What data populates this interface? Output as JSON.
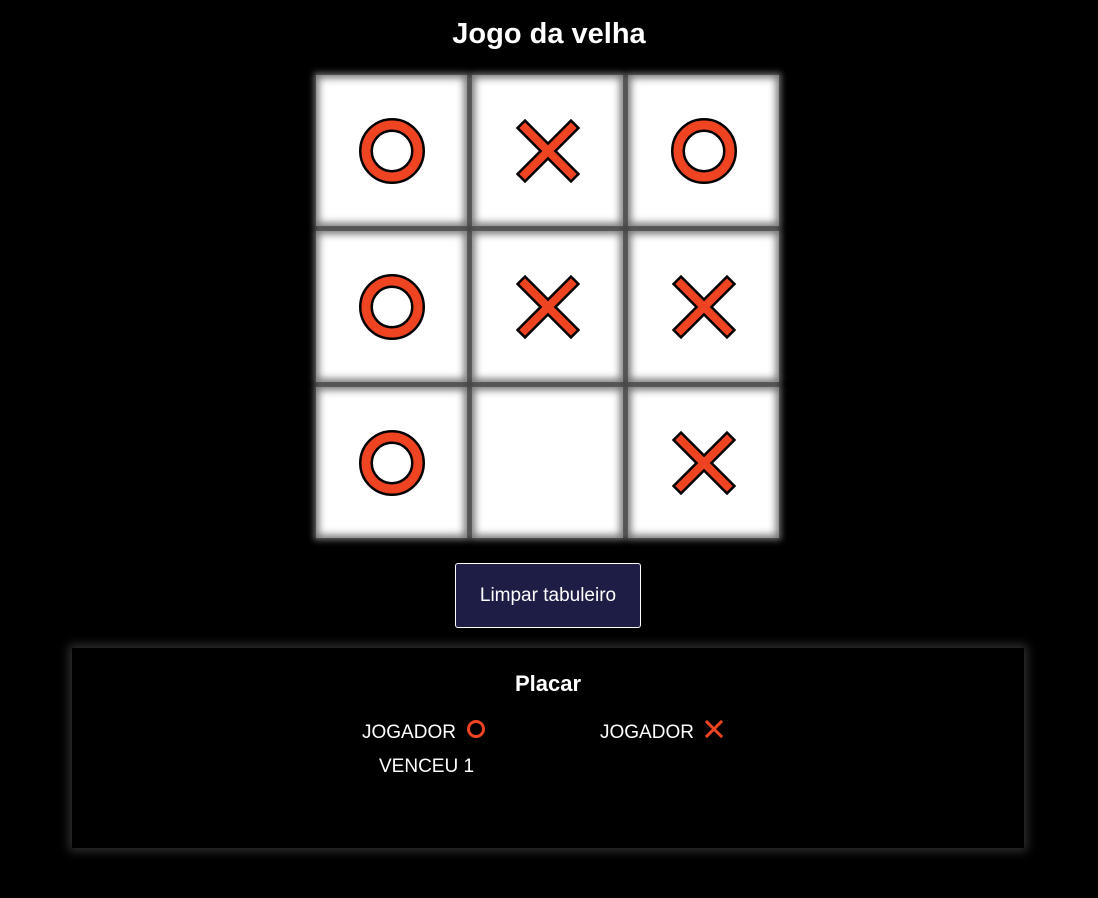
{
  "title": "Jogo da velha",
  "board": [
    [
      "O",
      "X",
      "O"
    ],
    [
      "O",
      "X",
      "X"
    ],
    [
      "O",
      "",
      "X"
    ]
  ],
  "reset_button_label": "Limpar tabuleiro",
  "scoreboard": {
    "title": "Placar",
    "player_o": {
      "label": "JOGADOR",
      "symbol_icon": "o-icon",
      "result": "VENCEU 1"
    },
    "player_x": {
      "label": "JOGADOR",
      "symbol_icon": "x-icon",
      "result": ""
    }
  },
  "colors": {
    "background": "#000000",
    "cell": "#ffffff",
    "mark_fill": "#ee4422",
    "mark_outline": "#000000",
    "button": "#1e1d45",
    "text": "#ffffff"
  }
}
